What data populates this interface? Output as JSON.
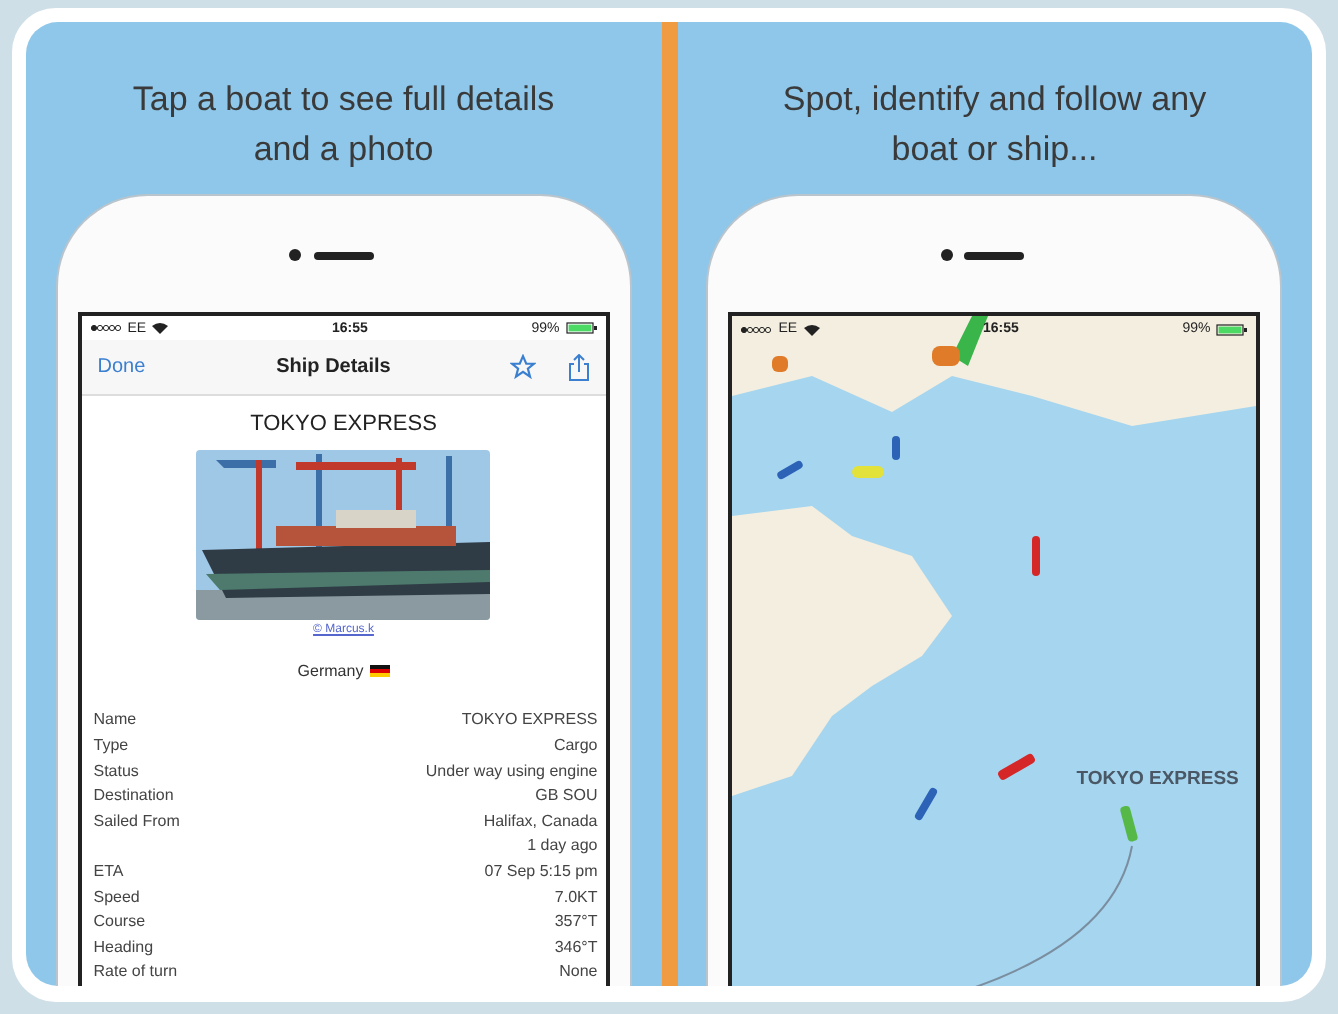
{
  "panels": [
    {
      "caption": "Tap a boat to see full details and a photo",
      "kind": "details",
      "status_bar": {
        "carrier": "EE",
        "time": "16:55",
        "battery": "99%"
      },
      "nav": {
        "back": "Done",
        "title": "Ship Details"
      },
      "ship_name": "TOKYO EXPRESS",
      "photo_credit": "© Marcus.k",
      "flag": "Germany",
      "rows": [
        {
          "label": "Name",
          "value": "TOKYO EXPRESS"
        },
        {
          "label": "Type",
          "value": "Cargo"
        },
        {
          "label": "Status",
          "value": "Under way using engine"
        },
        {
          "label": "Destination",
          "value": "GB SOU"
        },
        {
          "label": "Sailed From",
          "value": "Halifax, Canada\n1 day ago"
        },
        {
          "label": "ETA",
          "value": "07 Sep 5:15 pm"
        },
        {
          "label": "Speed",
          "value": "7.0KT"
        },
        {
          "label": "Course",
          "value": "357°T"
        },
        {
          "label": "Heading",
          "value": "346°T"
        },
        {
          "label": "Rate of turn",
          "value": "None"
        }
      ]
    },
    {
      "caption": "Spot, identify and follow any boat or ship...",
      "kind": "map",
      "status_bar": {
        "carrier": "EE",
        "time": "16:55",
        "battery": "99%"
      },
      "ship_label": "TOKYO EXPRESS"
    }
  ]
}
